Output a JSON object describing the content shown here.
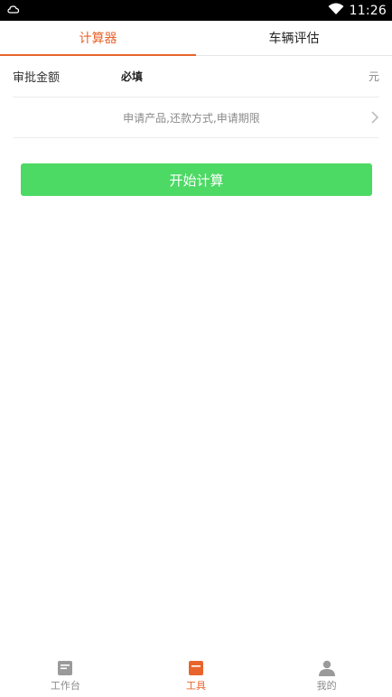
{
  "status_bar": {
    "time": "11:26",
    "icons": [
      "notification-icon",
      "wifi-icon"
    ]
  },
  "tabs": [
    {
      "label": "计算器",
      "active": true
    },
    {
      "label": "车辆评估",
      "active": false
    }
  ],
  "form": {
    "amount_label": "审批金额",
    "amount_placeholder": "必填",
    "amount_value": "",
    "amount_unit": "元",
    "product_select_text": "申请产品,还款方式,申请期限",
    "product_select_icon": "chevron-right-icon"
  },
  "start_button_label": "开始计算",
  "bottom_nav": [
    {
      "label": "工作台",
      "icon": "document-icon",
      "active": false
    },
    {
      "label": "工具",
      "icon": "toolbox-icon",
      "active": true
    },
    {
      "label": "我的",
      "icon": "person-icon",
      "active": false
    }
  ],
  "colors": {
    "accent": "#e8642c",
    "button": "#4cd964",
    "inactive_icon": "#9a9a9a"
  }
}
